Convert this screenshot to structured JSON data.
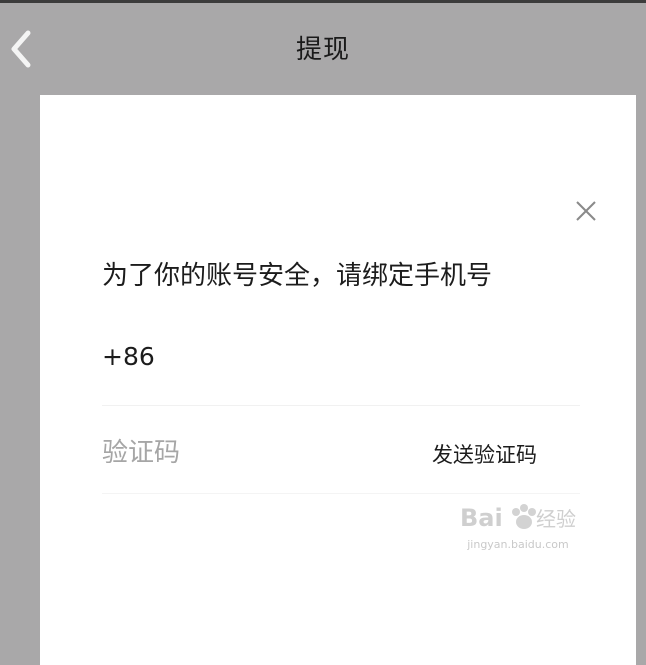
{
  "header": {
    "title": "提现",
    "back_icon": "chevron-left-icon"
  },
  "dialog": {
    "close_icon": "close-icon",
    "prompt": "为了你的账号安全，请绑定手机号",
    "country_code": "+86",
    "phone_value": "",
    "code_placeholder": "验证码",
    "send_code_label": "发送验证码"
  },
  "watermark": {
    "url": "jingyan.baidu.com"
  },
  "colors": {
    "header_bg": "#a9a8a9",
    "dialog_bg": "#ffffff",
    "text_primary": "#1c1c1c",
    "placeholder": "#a6a6a6"
  }
}
